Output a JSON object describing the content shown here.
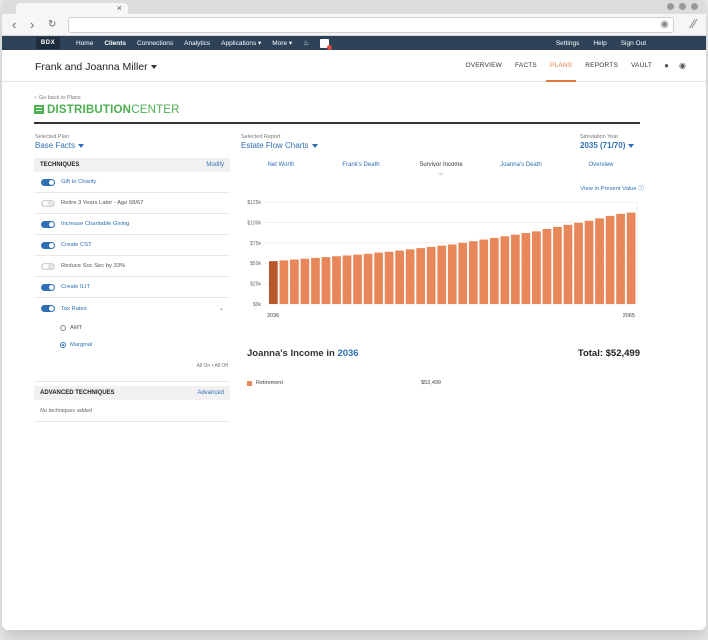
{
  "browser": {
    "tab_close": "×",
    "back_icon": "arrow-left-icon",
    "forward_icon": "arrow-right-icon",
    "reload_icon": "reload-icon",
    "globe_icon": "globe-icon",
    "menu_icon": "menu-icon"
  },
  "nav": {
    "brand": "BDX",
    "links": [
      "Home",
      "Clients",
      "Connections",
      "Analytics",
      "Applications ▾",
      "More ▾"
    ],
    "active": "Clients",
    "right_links": [
      "Settings",
      "Help",
      "Sign Out"
    ]
  },
  "header": {
    "client_name": "Frank and Joanna Miller",
    "tabs": [
      "OVERVIEW",
      "FACTS",
      "PLANS",
      "REPORTS",
      "VAULT"
    ],
    "active_tab": "PLANS"
  },
  "page": {
    "back_link": "Go back to Plans",
    "title_bold": "DISTRIBUTION",
    "title_light": "CENTER"
  },
  "selectors": {
    "plan_label": "Selected Plan",
    "plan_value": "Base Facts",
    "report_label": "Selected Report",
    "report_value": "Estate Flow Charts",
    "sim_label": "Simulation Year",
    "sim_value": "2035 (71/70)"
  },
  "techniques": {
    "header": "TECHNIQUES",
    "modify": "Modify",
    "items": [
      {
        "label": "Gift to Charity",
        "on": true
      },
      {
        "label": "Retire 3 Years Later - Age 68/67",
        "on": false
      },
      {
        "label": "Increase Charitable Giving",
        "on": true
      },
      {
        "label": "Create CST",
        "on": true
      },
      {
        "label": "Reduce Soc Sec by 33%",
        "on": false
      },
      {
        "label": "Create ILIT",
        "on": true
      },
      {
        "label": "Tax Rates",
        "on": true
      }
    ],
    "radios": [
      {
        "label": "AMT",
        "selected": false
      },
      {
        "label": "Marginal",
        "selected": true
      }
    ],
    "all_toggle": "All On • All Off"
  },
  "advanced": {
    "header": "ADVANCED TECHNIQUES",
    "link": "Advanced",
    "empty": "No techniques added"
  },
  "report_tabs": [
    "Net Worth",
    "Frank's Death",
    "Survivor Income",
    "Joanna's Death",
    "Overview"
  ],
  "active_report_tab": "Survivor Income",
  "present_value_link": "View in Present Value ⓘ",
  "chart_data": {
    "type": "bar",
    "y_ticks": [
      "$125k",
      "$100k",
      "$75k",
      "$50k",
      "$25k",
      "$0k"
    ],
    "ylim": [
      0,
      125
    ],
    "x_start_label": "2036",
    "x_end_label": "2065",
    "highlight_index": 0,
    "colors": {
      "bar": "#e8885a",
      "highlight": "#b8562c"
    },
    "series": [
      {
        "values": [
          52.5,
          53.5,
          54.5,
          55.5,
          56.5,
          57.5,
          58.5,
          59.5,
          60.5,
          61.5,
          63,
          64,
          65.5,
          67,
          68.5,
          70,
          71.5,
          73,
          75,
          77,
          79,
          81,
          83,
          85,
          87,
          89,
          92,
          94.5,
          97,
          99.5,
          102,
          105,
          108,
          110.5,
          112
        ]
      }
    ]
  },
  "income": {
    "title_prefix": "Joanna's Income in",
    "year": "2036",
    "total": "Total: $52,499",
    "rows": [
      {
        "label": "Retirement",
        "value": "$52,499"
      }
    ]
  }
}
